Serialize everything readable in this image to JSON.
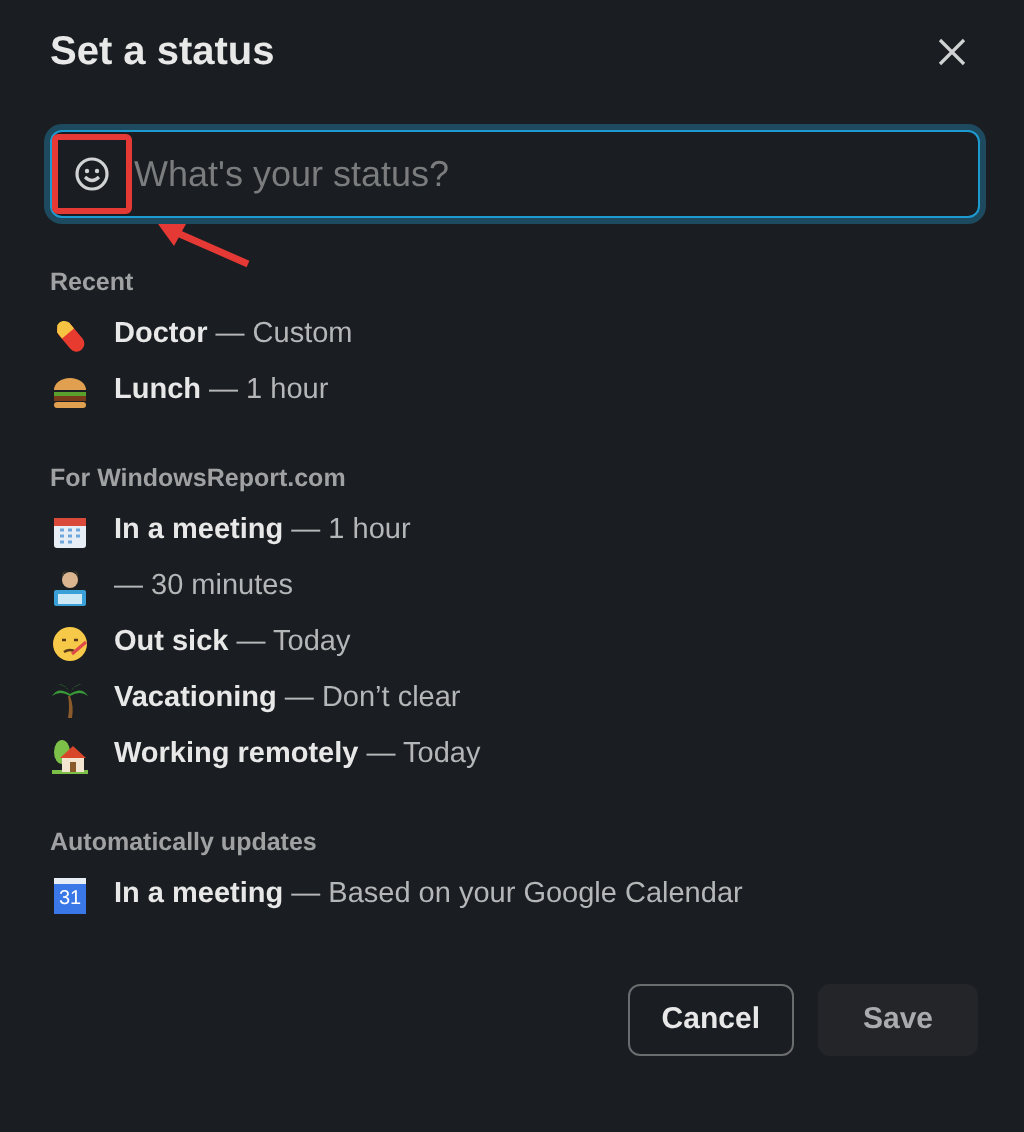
{
  "dialog": {
    "title": "Set a status"
  },
  "status_field": {
    "placeholder": "What's your status?"
  },
  "annotations": {
    "highlight_box": true,
    "arrow": true
  },
  "sections": [
    {
      "heading": "Recent",
      "items": [
        {
          "label": "Doctor",
          "detail": "— Custom"
        },
        {
          "label": "Lunch",
          "detail": "— 1 hour"
        }
      ]
    },
    {
      "heading": "For WindowsReport.com",
      "items": [
        {
          "label": "In a meeting",
          "detail": "— 1 hour"
        },
        {
          "detail": "— 30 minutes"
        },
        {
          "label": "Out sick",
          "detail": "— Today"
        },
        {
          "label": "Vacationing",
          "detail": "— Don’t clear"
        },
        {
          "label": "Working remotely",
          "detail": "— Today"
        }
      ]
    },
    {
      "heading": "Automatically updates",
      "items": [
        {
          "icon_text": "31",
          "label": "In a meeting",
          "detail": "— Based on your Google Calendar"
        }
      ]
    }
  ],
  "buttons": [
    {
      "label": "Cancel",
      "kind": "secondary"
    },
    {
      "label": "Save",
      "kind": "disabled"
    }
  ]
}
